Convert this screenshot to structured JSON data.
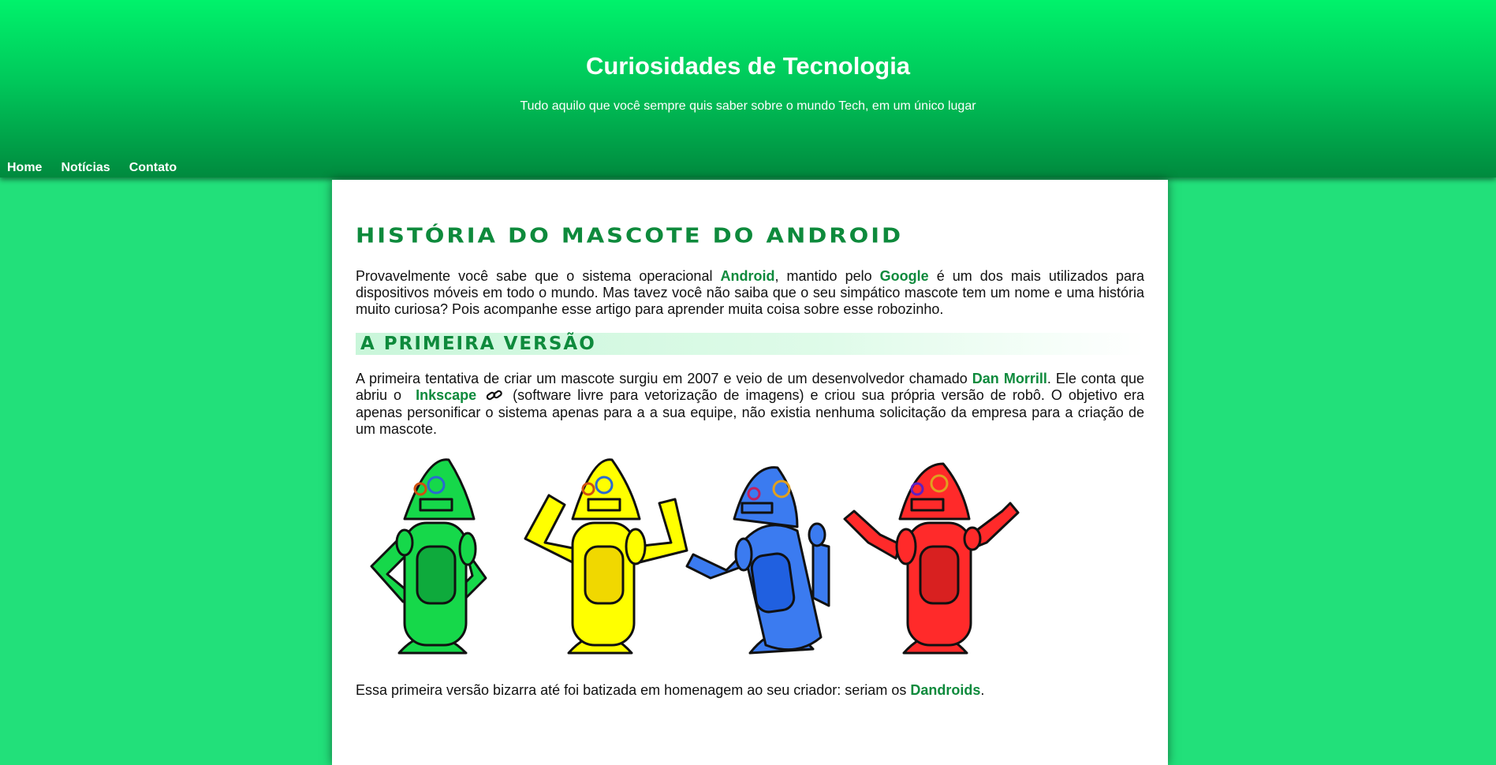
{
  "site": {
    "title": "Curiosidades de Tecnologia",
    "subtitle": "Tudo aquilo que você sempre quis saber sobre o mundo Tech, em um único lugar"
  },
  "nav": {
    "items": [
      {
        "label": "Home"
      },
      {
        "label": "Notícias"
      },
      {
        "label": "Contato"
      }
    ]
  },
  "article": {
    "title": "História do Mascote do Android",
    "intro": {
      "t1": "Provavelmente você sabe que o sistema operacional ",
      "android": "Android",
      "t2": ", mantido pelo ",
      "google": "Google",
      "t3": " é um dos mais utilizados para dispositivos móveis em todo o mundo. Mas tavez você não saiba que o seu simpático mascote tem um nome e uma história muito curiosa? Pois acompanhe esse artigo para aprender muita coisa sobre esse robozinho."
    },
    "section1": {
      "heading": "A Primeira Versão",
      "p1": {
        "t1": "A primeira tentativa de criar um mascote surgiu em 2007 e veio de um desenvolvedor chamado ",
        "dan": "Dan Morrill",
        "t2": ". Ele conta que abriu o ",
        "inkscape": "Inkscape",
        "t3": " (software livre para vetorização de imagens) e criou sua própria versão de robô. O objetivo era apenas personificar o sistema apenas para a a sua equipe, não existia nenhuma solicitação da empresa para a criação de um mascote."
      },
      "p2": {
        "t1": "Essa primeira versão bizarra até foi batizada em homenagem ao seu criador: seriam os ",
        "dandroids": "Dandroids",
        "t2": "."
      }
    }
  },
  "colors": {
    "accent": "#0e8a3c",
    "background": "#22e07a",
    "robots": [
      "#16d84a",
      "#ffff00",
      "#3b7bf0",
      "#ff2a2a"
    ]
  }
}
